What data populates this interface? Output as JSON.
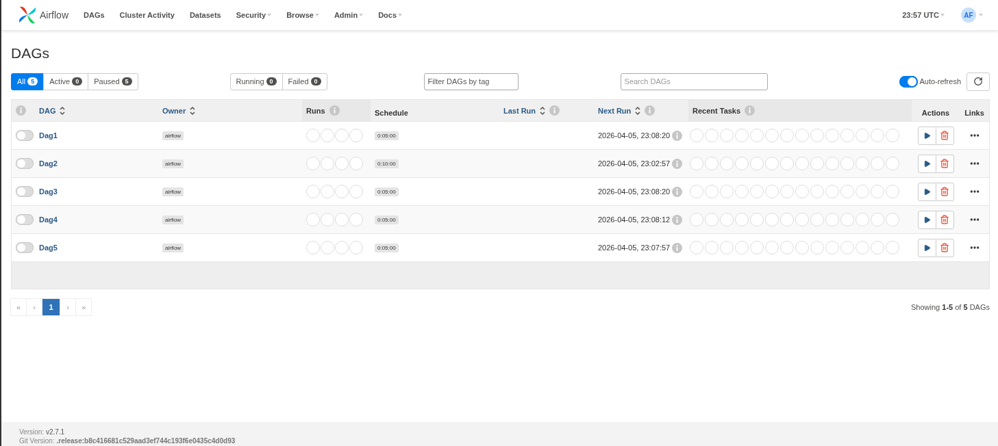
{
  "nav": {
    "brand": "Airflow",
    "items": [
      {
        "label": "DAGs",
        "dropdown": false
      },
      {
        "label": "Cluster Activity",
        "dropdown": false
      },
      {
        "label": "Datasets",
        "dropdown": false
      },
      {
        "label": "Security",
        "dropdown": true
      },
      {
        "label": "Browse",
        "dropdown": true
      },
      {
        "label": "Admin",
        "dropdown": true
      },
      {
        "label": "Docs",
        "dropdown": true
      }
    ],
    "time": "23:57 UTC",
    "user": "AF"
  },
  "title": "DAGs",
  "status_filters": [
    {
      "label": "All",
      "count": "5",
      "selected": true
    },
    {
      "label": "Active",
      "count": "0",
      "selected": false
    },
    {
      "label": "Paused",
      "count": "5",
      "selected": false
    }
  ],
  "state_filters": [
    {
      "label": "Running",
      "count": "0",
      "selected": false
    },
    {
      "label": "Failed",
      "count": "0",
      "selected": false
    }
  ],
  "tag_filter": {
    "placeholder": "Filter DAGs by tag"
  },
  "search": {
    "placeholder": "Search DAGs"
  },
  "auto_refresh": {
    "label": "Auto-refresh",
    "on": true
  },
  "columns": [
    {
      "info": true,
      "sortable": false
    },
    {
      "label": "DAG",
      "sortable": true,
      "info": false
    },
    {
      "label": "Owner",
      "sortable": true,
      "info": false
    },
    {
      "label": "Runs",
      "sortable": false,
      "info": true
    },
    {
      "label": "Schedule",
      "sortable": false,
      "info": false
    },
    {
      "label": "Last Run",
      "sortable": true,
      "info": true
    },
    {
      "label": "Next Run",
      "sortable": true,
      "info": true
    },
    {
      "label": "Recent Tasks",
      "sortable": false,
      "info": true
    },
    {
      "label": "Actions",
      "sortable": false,
      "info": false
    },
    {
      "label": "Links",
      "sortable": false,
      "info": false
    }
  ],
  "rows": [
    {
      "active": false,
      "dag": "Dag1",
      "owner": "airflow",
      "schedule": "0:05:00",
      "next_run": "2026-04-05, 23:08:20"
    },
    {
      "active": false,
      "dag": "Dag2",
      "owner": "airflow",
      "schedule": "0:10:00",
      "next_run": "2026-04-05, 23:02:57"
    },
    {
      "active": false,
      "dag": "Dag3",
      "owner": "airflow",
      "schedule": "0:05:00",
      "next_run": "2026-04-05, 23:08:20"
    },
    {
      "active": false,
      "dag": "Dag4",
      "owner": "airflow",
      "schedule": "0:05:00",
      "next_run": "2026-04-05, 23:08:12"
    },
    {
      "active": false,
      "dag": "Dag5",
      "owner": "airflow",
      "schedule": "0:05:00",
      "next_run": "2026-04-05, 23:07:57"
    }
  ],
  "pagination": {
    "first": "«",
    "prev": "‹",
    "pages": [
      {
        "label": "1",
        "selected": true
      }
    ],
    "next": "›",
    "last": "»"
  },
  "showing": "Showing **1-5** of **5** DAGs",
  "footer": {
    "version_label": "Version:",
    "version": "v2.7.1",
    "git_label": "Git Version:",
    "git": ".release:b8c416681c529aad3ef744c193f6e0435c4d0d93"
  }
}
